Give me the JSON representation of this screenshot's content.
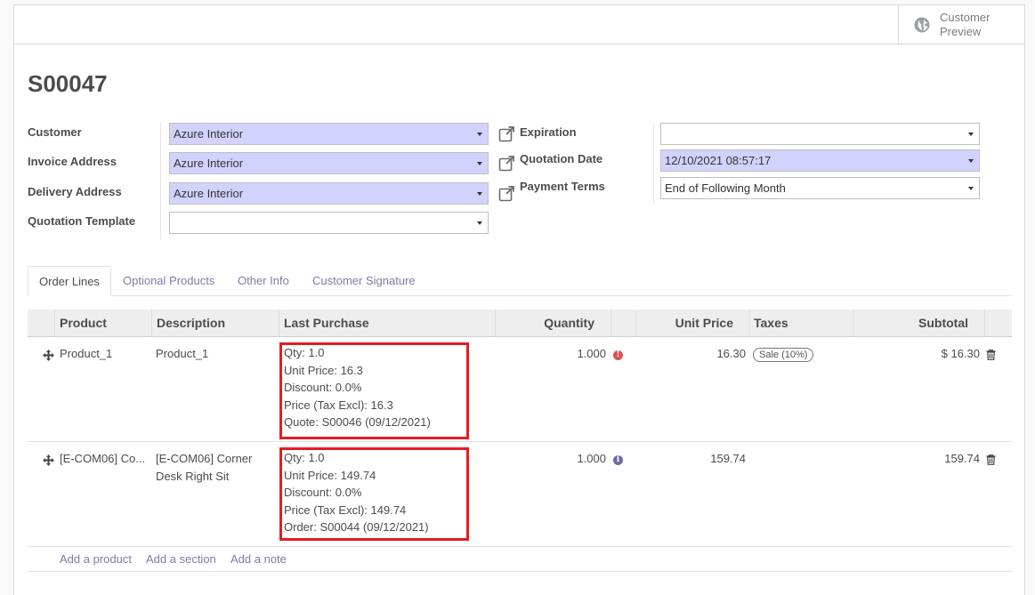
{
  "header": {
    "preview_label": "Customer Preview"
  },
  "record": {
    "name": "S00047"
  },
  "form": {
    "customer_label": "Customer",
    "customer_value": "Azure Interior",
    "invoice_address_label": "Invoice Address",
    "invoice_address_value": "Azure Interior",
    "delivery_address_label": "Delivery Address",
    "delivery_address_value": "Azure Interior",
    "quotation_template_label": "Quotation Template",
    "quotation_template_value": "",
    "expiration_label": "Expiration",
    "expiration_value": "",
    "quotation_date_label": "Quotation Date",
    "quotation_date_value": "12/10/2021 08:57:17",
    "payment_terms_label": "Payment Terms",
    "payment_terms_value": "End of Following Month"
  },
  "tabs": [
    "Order Lines",
    "Optional Products",
    "Other Info",
    "Customer Signature"
  ],
  "table": {
    "columns": [
      "Product",
      "Description",
      "Last Purchase",
      "Quantity",
      "Unit Price",
      "Taxes",
      "Subtotal"
    ],
    "rows": [
      {
        "product": "Product_1",
        "description": "Product_1",
        "last_purchase": [
          "Qty: 1.0",
          "Unit Price: 16.3",
          "Discount: 0.0%",
          "Price (Tax Excl): 16.3",
          "Quote: S00046 (09/12/2021)"
        ],
        "quantity": "1.000",
        "info_color": "#d9534f",
        "unit_price": "16.30",
        "tax": "Sale (10%)",
        "subtotal": "$ 16.30"
      },
      {
        "product": "[E-COM06] Co...",
        "description": "[E-COM06] Corner Desk Right Sit",
        "last_purchase": [
          "Qty: 1.0",
          "Unit Price: 149.74",
          "Discount: 0.0%",
          "Price (Tax Excl): 149.74",
          "Order: S00044 (09/12/2021)"
        ],
        "quantity": "1.000",
        "info_color": "#6b6ba8",
        "unit_price": "159.74",
        "tax": "",
        "subtotal": "159.74"
      }
    ],
    "add_product": "Add a product",
    "add_section": "Add a section",
    "add_note": "Add a note"
  },
  "colors": {
    "accent": "#7c7bad",
    "required_bg": "#d2d2ff",
    "highlight": "#e51c24"
  },
  "icons": {
    "preview": "globe-icon",
    "external": "external-link-icon",
    "move": "move-handle-icon",
    "delete": "trash-icon",
    "info": "info-icon",
    "dropdown": "caret-down-icon"
  }
}
